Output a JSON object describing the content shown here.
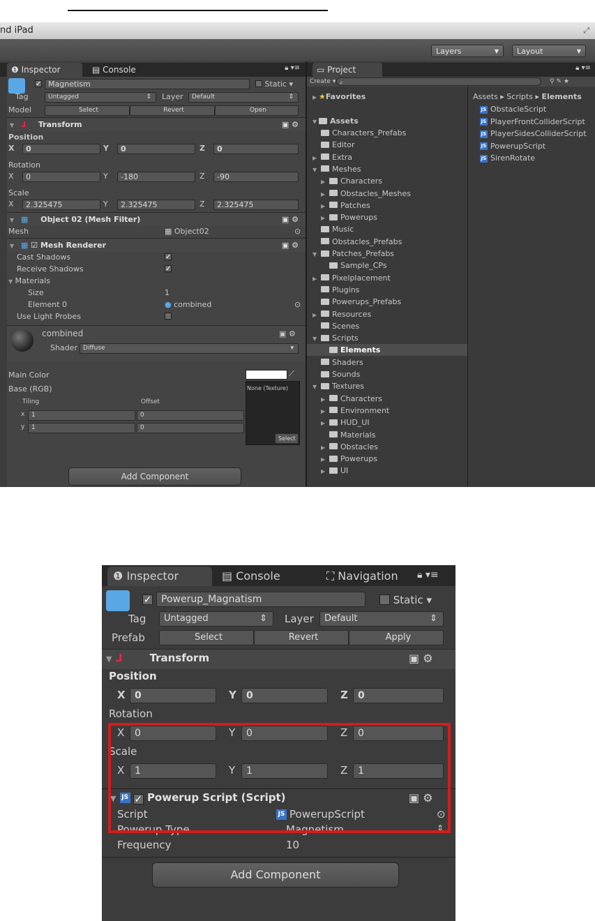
{
  "top": {
    "window_title": "nd iPad",
    "toolbar": {
      "layers": "Layers",
      "layout": "Layout"
    },
    "inspector": {
      "tabs": [
        "Inspector",
        "Console"
      ],
      "object_name": "Magnetism",
      "static": "Static",
      "tag_label": "Tag",
      "tag_value": "Untagged",
      "layer_label": "Layer",
      "layer_value": "Default",
      "model_label": "Model",
      "model_buttons": [
        "Select",
        "Revert",
        "Open"
      ],
      "transform": {
        "title": "Transform",
        "position_label": "Position",
        "position": [
          "0",
          "0",
          "0"
        ],
        "rotation_label": "Rotation",
        "rotation": [
          "0",
          "-180",
          "-90"
        ],
        "scale_label": "Scale",
        "scale": [
          "2.325475",
          "2.325475",
          "2.325475"
        ],
        "axes": [
          "X",
          "Y",
          "Z"
        ]
      },
      "mesh_filter": {
        "title": "Object 02 (Mesh Filter)",
        "mesh_label": "Mesh",
        "mesh_value": "Object02"
      },
      "mesh_renderer": {
        "title": "Mesh Renderer",
        "cast_shadows": "Cast Shadows",
        "receive_shadows": "Receive Shadows",
        "materials": "Materials",
        "size_label": "Size",
        "size_value": "1",
        "element0_label": "Element 0",
        "element0_value": "combined",
        "light_probes": "Use Light Probes"
      },
      "material": {
        "name": "combined",
        "shader_label": "Shader",
        "shader_value": "Diffuse",
        "main_color": "Main Color",
        "base": "Base (RGB)",
        "texture_none": "None (Texture)",
        "tiling": "Tiling",
        "offset": "Offset",
        "x_label": "x",
        "x_tiling": "1",
        "x_offset": "0",
        "y_label": "y",
        "y_tiling": "1",
        "y_offset": "0",
        "select": "Select"
      },
      "add_component": "Add Component"
    },
    "project": {
      "tab": "Project",
      "create": "Create",
      "favorites": "Favorites",
      "assets": "Assets",
      "breadcrumb": [
        "Assets",
        "Scripts",
        "Elements"
      ],
      "folders": [
        {
          "label": "Characters_Prefabs",
          "level": 1,
          "arrow": false
        },
        {
          "label": "Editor",
          "level": 1,
          "arrow": false
        },
        {
          "label": "Extra",
          "level": 1,
          "arrow": true
        },
        {
          "label": "Meshes",
          "level": 1,
          "arrow": true,
          "open": true
        },
        {
          "label": "Characters",
          "level": 2,
          "arrow": true
        },
        {
          "label": "Obstacles_Meshes",
          "level": 2,
          "arrow": true
        },
        {
          "label": "Patches",
          "level": 2,
          "arrow": true
        },
        {
          "label": "Powerups",
          "level": 2,
          "arrow": true
        },
        {
          "label": "Music",
          "level": 1,
          "arrow": false
        },
        {
          "label": "Obstacles_Prefabs",
          "level": 1,
          "arrow": false
        },
        {
          "label": "Patches_Prefabs",
          "level": 1,
          "arrow": true,
          "open": true
        },
        {
          "label": "Sample_CPs",
          "level": 2,
          "arrow": false
        },
        {
          "label": "Pixelplacement",
          "level": 1,
          "arrow": true
        },
        {
          "label": "Plugins",
          "level": 1,
          "arrow": false
        },
        {
          "label": "Powerups_Prefabs",
          "level": 1,
          "arrow": false
        },
        {
          "label": "Resources",
          "level": 1,
          "arrow": true
        },
        {
          "label": "Scenes",
          "level": 1,
          "arrow": false
        },
        {
          "label": "Scripts",
          "level": 1,
          "arrow": true,
          "open": true
        },
        {
          "label": "Elements",
          "level": 2,
          "arrow": false,
          "selected": true
        },
        {
          "label": "Shaders",
          "level": 1,
          "arrow": false
        },
        {
          "label": "Sounds",
          "level": 1,
          "arrow": false
        },
        {
          "label": "Textures",
          "level": 1,
          "arrow": true,
          "open": true
        },
        {
          "label": "Characters",
          "level": 2,
          "arrow": true
        },
        {
          "label": "Environment",
          "level": 2,
          "arrow": true
        },
        {
          "label": "HUD_UI",
          "level": 2,
          "arrow": true
        },
        {
          "label": "Materials",
          "level": 2,
          "arrow": false
        },
        {
          "label": "Obstacles",
          "level": 2,
          "arrow": true
        },
        {
          "label": "Powerups",
          "level": 2,
          "arrow": true
        },
        {
          "label": "UI",
          "level": 2,
          "arrow": true
        }
      ],
      "files": [
        "ObstacleScript",
        "PlayerFrontColliderScript",
        "PlayerSidesColliderScript",
        "PowerupScript",
        "SirenRotate"
      ]
    }
  },
  "bottom": {
    "tabs": [
      "Inspector",
      "Console",
      "Navigation"
    ],
    "object_name": "Powerup_Magnatism",
    "static": "Static",
    "tag_label": "Tag",
    "tag_value": "Untagged",
    "layer_label": "Layer",
    "layer_value": "Default",
    "prefab_label": "Prefab",
    "prefab_buttons": [
      "Select",
      "Revert",
      "Apply"
    ],
    "transform": {
      "title": "Transform",
      "position_label": "Position",
      "position": [
        "0",
        "0",
        "0"
      ],
      "rotation_label": "Rotation",
      "rotation": [
        "0",
        "0",
        "0"
      ],
      "scale_label": "Scale",
      "scale": [
        "1",
        "1",
        "1"
      ],
      "axes": [
        "X",
        "Y",
        "Z"
      ]
    },
    "script_component": {
      "title": "Powerup Script (Script)",
      "script_label": "Script",
      "script_value": "PowerupScript",
      "type_label": "Powerup Type",
      "type_value": "Magnetism",
      "freq_label": "Frequency",
      "freq_value": "10"
    },
    "add_component": "Add Component"
  }
}
